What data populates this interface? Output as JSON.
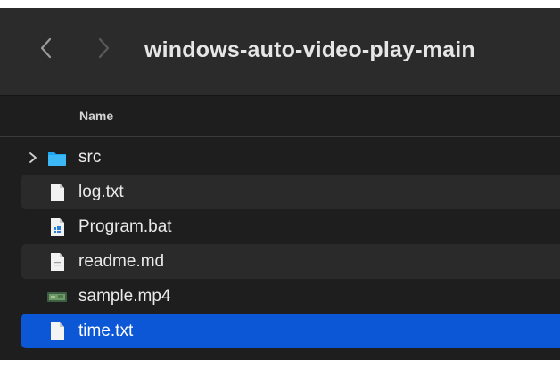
{
  "window": {
    "title": "windows-auto-video-play-main"
  },
  "navigation": {
    "back_icon": "chevron-left-icon",
    "forward_icon": "chevron-right-icon"
  },
  "columns": {
    "name": "Name"
  },
  "files": [
    {
      "name": "src",
      "icon": "folder-icon",
      "kind": "folder",
      "expanded": false,
      "selected": false
    },
    {
      "name": "log.txt",
      "icon": "text-file-icon",
      "kind": "file",
      "selected": false
    },
    {
      "name": "Program.bat",
      "icon": "batch-file-icon",
      "kind": "file",
      "selected": false
    },
    {
      "name": "readme.md",
      "icon": "markdown-file-icon",
      "kind": "file",
      "selected": false
    },
    {
      "name": "sample.mp4",
      "icon": "video-file-icon",
      "kind": "file",
      "selected": false
    },
    {
      "name": "time.txt",
      "icon": "text-file-icon",
      "kind": "file",
      "selected": true
    }
  ],
  "colors": {
    "toolbar_bg": "#2b2b2b",
    "list_bg": "#1e1e1e",
    "alt_row_bg": "#2a2a2a",
    "selection": "#0b57d6",
    "folder": "#1ea7f0",
    "text": "#eaeaea"
  }
}
